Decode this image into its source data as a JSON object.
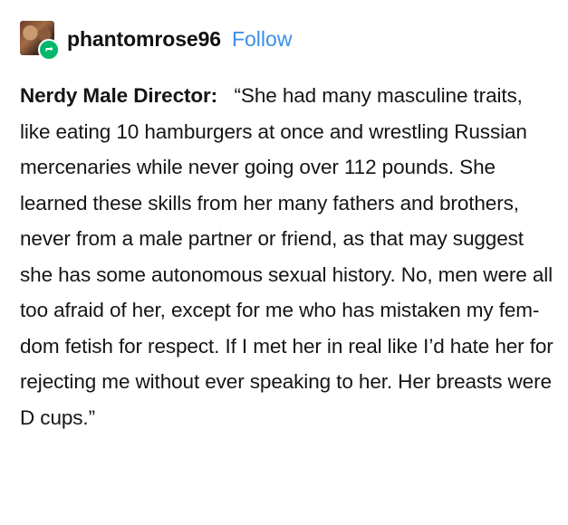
{
  "post": {
    "username": "phantomrose96",
    "follow_label": "Follow",
    "avatar_icon": "user-avatar",
    "badge_icon": "reblog-icon",
    "badge_color": "#00b86b",
    "follow_color": "#3a8fe8",
    "speaker": "Nerdy Male Director:",
    "quote": "“She had many masculine traits, like eating 10 hamburgers at once and wrestling Russian mercenaries while never going over 112 pounds. She learned these skills from her many fathers and brothers, never from a male partner or friend, as that may suggest she has some autonomous sexual history. No, men were all too afraid of her, except for me who has mistaken my fem-dom fetish for respect. If I met her in real like I’d hate her for rejecting me without ever speaking to her. Her breasts were D cups.”"
  }
}
